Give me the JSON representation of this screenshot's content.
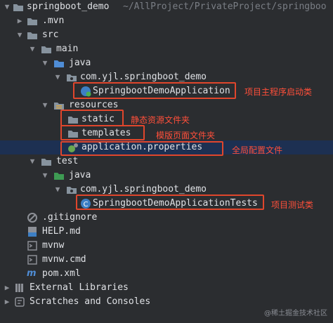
{
  "tree": {
    "root": {
      "name": "springboot_demo",
      "path": "~/AllProject/PrivateProject/springboo"
    },
    "mvn": ".mvn",
    "src": "src",
    "main": "main",
    "main_java": "java",
    "main_pkg": "com.yjl.springboot_demo",
    "app_class": "SpringbootDemoApplication",
    "resources": "resources",
    "static": "static",
    "templates": "templates",
    "app_props": "application.properties",
    "test": "test",
    "test_java": "java",
    "test_pkg": "com.yjl.springboot_demo",
    "test_class": "SpringbootDemoApplicationTests",
    "gitignore": ".gitignore",
    "help": "HELP.md",
    "mvnw": "mvnw",
    "mvnw_cmd": "mvnw.cmd",
    "pom": "pom.xml",
    "external_libs": "External Libraries",
    "scratches": "Scratches and Consoles"
  },
  "annotations": {
    "app_class": "项目主程序启动类",
    "static": "静态资源文件夹",
    "templates": "模版页面文件夹",
    "app_props": "全局配置文件",
    "test_class": "项目测试类"
  },
  "watermark": "@稀土掘金技术社区",
  "colors": {
    "folder": "#87939e",
    "source_folder": "#4f8dd6",
    "resource_folder": "#d9a441",
    "test_folder": "#3e9b53",
    "annotation": "#ff4f3a",
    "selected_row": "#1d3052"
  }
}
